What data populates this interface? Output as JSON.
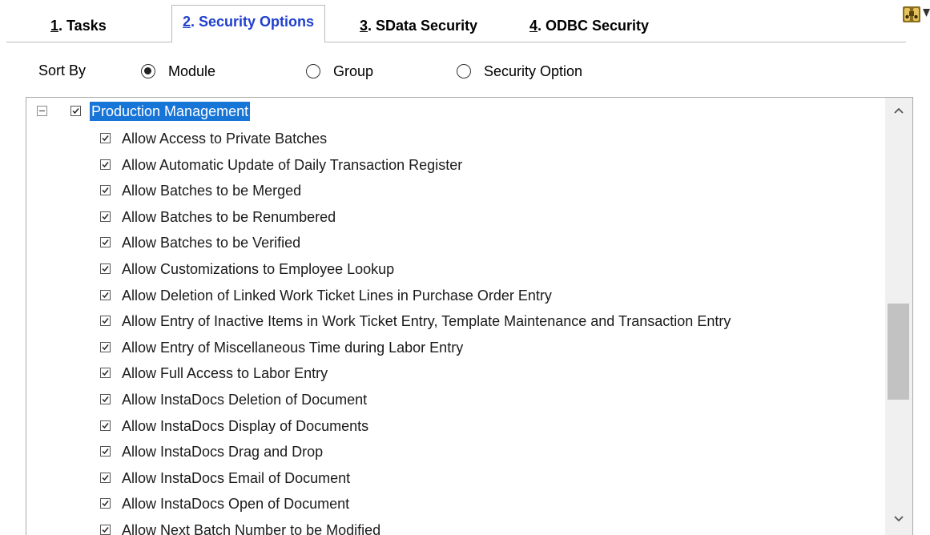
{
  "tabs": [
    {
      "num": "1",
      "rest": ". Tasks",
      "active": false
    },
    {
      "num": "2",
      "rest": ". Security Options",
      "active": true
    },
    {
      "num": "3",
      "rest": ". SData Security",
      "active": false
    },
    {
      "num": "4",
      "rest": ". ODBC Security",
      "active": false
    }
  ],
  "sort": {
    "label": "Sort By",
    "options": [
      {
        "label": "Module",
        "checked": true
      },
      {
        "label": "Group",
        "checked": false
      },
      {
        "label": "Security Option",
        "checked": false
      }
    ]
  },
  "tree": {
    "root": {
      "label": "Production Management",
      "checked": true,
      "expanded": true
    },
    "items": [
      {
        "label": "Allow Access to Private Batches",
        "checked": true
      },
      {
        "label": "Allow Automatic Update of Daily Transaction Register",
        "checked": true
      },
      {
        "label": "Allow Batches to be Merged",
        "checked": true
      },
      {
        "label": "Allow Batches to be Renumbered",
        "checked": true
      },
      {
        "label": "Allow Batches to be Verified",
        "checked": true
      },
      {
        "label": "Allow Customizations to Employee Lookup",
        "checked": true
      },
      {
        "label": "Allow Deletion of Linked Work Ticket Lines in Purchase Order Entry",
        "checked": true
      },
      {
        "label": "Allow Entry of Inactive Items in Work Ticket Entry, Template Maintenance and Transaction Entry",
        "checked": true
      },
      {
        "label": "Allow Entry of Miscellaneous Time during Labor Entry",
        "checked": true
      },
      {
        "label": "Allow Full Access to Labor Entry",
        "checked": true
      },
      {
        "label": "Allow InstaDocs Deletion of Document",
        "checked": true
      },
      {
        "label": "Allow InstaDocs Display of Documents",
        "checked": true
      },
      {
        "label": "Allow InstaDocs Drag and Drop",
        "checked": true
      },
      {
        "label": "Allow InstaDocs Email of Document",
        "checked": true
      },
      {
        "label": "Allow InstaDocs Open of Document",
        "checked": true
      },
      {
        "label": "Allow Next Batch Number to be Modified",
        "checked": true
      }
    ]
  },
  "colors": {
    "active_tab": "#1f3fcf",
    "selection": "#1875d8"
  },
  "icons": {
    "corner": "binoculars-icon",
    "dropdown": "triangle-down-icon"
  }
}
